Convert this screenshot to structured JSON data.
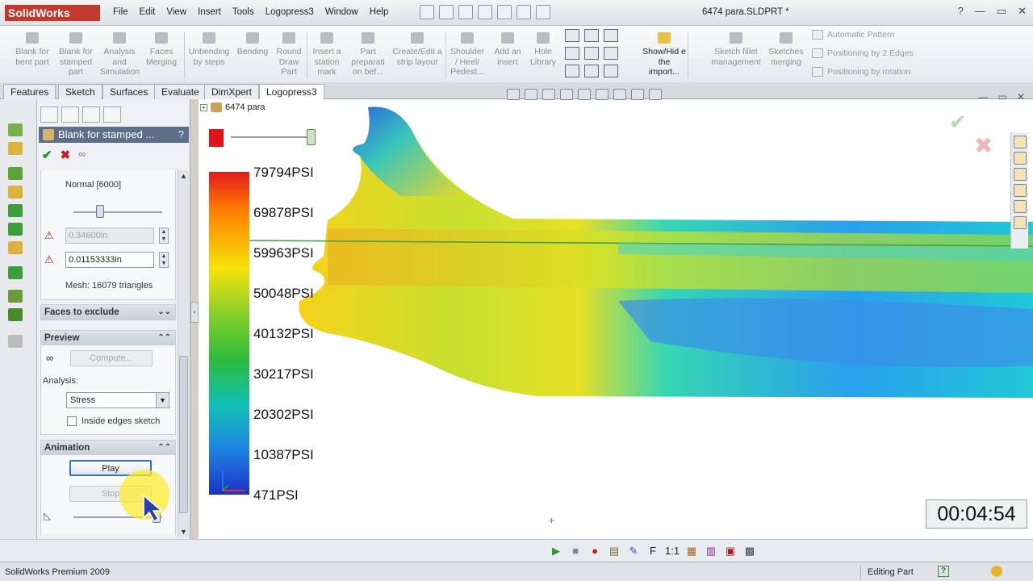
{
  "app": {
    "logo": "SolidWorks",
    "doc_title": "6474 para.SLDPRT *"
  },
  "menu": [
    "File",
    "Edit",
    "View",
    "Insert",
    "Tools",
    "Logopress3",
    "Window",
    "Help"
  ],
  "ribbon": {
    "buttons": [
      {
        "label": "Blank for bent part"
      },
      {
        "label": "Blank for stamped part"
      },
      {
        "label": "Analysis and Simulation"
      },
      {
        "label": "Faces Merging"
      },
      {
        "label": "Unbending by steps"
      },
      {
        "label": "Bending"
      },
      {
        "label": "Round Draw Part"
      },
      {
        "label": "Insert a station mark"
      },
      {
        "label": "Part preparati on bef..."
      },
      {
        "label": "Create/Edit a strip layout"
      },
      {
        "label": "Shoulder / Heel/ Pedest..."
      },
      {
        "label": "Add an insert"
      },
      {
        "label": "Hole Library"
      },
      {
        "label": "Show/Hid e the import..."
      },
      {
        "label": "Sketch fillet management"
      },
      {
        "label": "Sketches merging"
      }
    ],
    "small_buttons": [
      "Automatic Pattern",
      "Positioning by 2 Edges",
      "Positioning by rotation"
    ]
  },
  "tabs": [
    {
      "label": "Features",
      "active": false
    },
    {
      "label": "Sketch",
      "active": false
    },
    {
      "label": "Surfaces",
      "active": false
    },
    {
      "label": "Evaluate",
      "active": false
    },
    {
      "label": "DimXpert",
      "active": false
    },
    {
      "label": "Logopress3",
      "active": true
    }
  ],
  "property_manager": {
    "title": "Blank for stamped ...",
    "help": "?",
    "mesh": {
      "quality_label": "Normal [6000]",
      "quality_level": 0.28,
      "field1_value": "0.34600in",
      "field2_value": "0.01153333in",
      "mesh_info": "Mesh: 16079 triangles"
    },
    "faces_to_exclude": {
      "title": "Faces to exclude"
    },
    "preview": {
      "title": "Preview",
      "compute_label": "Compute...",
      "analysis_label": "Analysis:",
      "analysis_value": "Stress",
      "inside_edges_label": "Inside edges sketch",
      "inside_edges_checked": false
    },
    "animation": {
      "title": "Animation",
      "play_label": "Play",
      "stop_label": "Stop",
      "speed_level": 0.98
    }
  },
  "viewport": {
    "tree_label": "6474 para",
    "legend": [
      "79794PSI",
      "69878PSI",
      "59963PSI",
      "50048PSI",
      "40132PSI",
      "30217PSI",
      "20302PSI",
      "10387PSI",
      "471PSI"
    ],
    "timer": "00:04:54"
  },
  "anim_toolbar": {
    "f_label": "F",
    "ratio_label": "1:1"
  },
  "status": {
    "left": "SolidWorks Premium 2009",
    "mode": "Editing Part"
  }
}
